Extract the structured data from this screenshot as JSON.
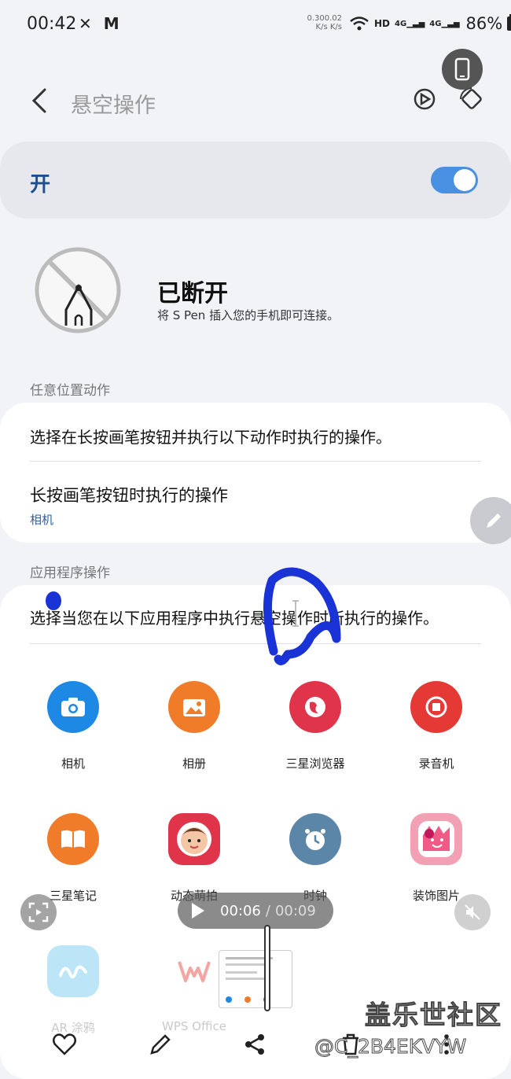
{
  "status_bar": {
    "time": "00:42",
    "left_icons": "✕ M",
    "speed_up": "0.30",
    "speed_down": "0.02",
    "speed_unit_up": "K/s",
    "speed_unit_down": "K/s",
    "network": "HD",
    "signal1": "4G",
    "signal2": "4G",
    "battery": "86%"
  },
  "header": {
    "title": "悬空操作",
    "icons": [
      "back-arrow-icon",
      "screen-rotate-icon",
      "auto-rotate-icon",
      "phone-icon"
    ]
  },
  "master_switch": {
    "label": "开",
    "state": "on",
    "accent": "#4a90e2"
  },
  "pen_status": {
    "title": "已断开",
    "description": "将 S Pen 插入您的手机即可连接。"
  },
  "anywhere_section": {
    "label": "任意位置动作",
    "description": "选择在长按画笔按钮并执行以下动作时执行的操作。",
    "long_press_title": "长按画笔按钮时执行的操作",
    "long_press_value": "相机"
  },
  "app_section": {
    "label": "应用程序操作",
    "description": "选择当您在以下应用程序中执行悬空操作时所执行的操作。",
    "apps": [
      {
        "name": "相机",
        "color": "#1e88e5",
        "icon": "camera-icon"
      },
      {
        "name": "相册",
        "color": "#f07c2a",
        "icon": "gallery-icon"
      },
      {
        "name": "三星浏览器",
        "color": "#e0344a",
        "icon": "browser-icon"
      },
      {
        "name": "录音机",
        "color": "#e53935",
        "icon": "recorder-icon"
      },
      {
        "name": "三星笔记",
        "color": "#f07c2a",
        "icon": "notes-icon"
      },
      {
        "name": "动态萌拍",
        "color": "#e0344a",
        "icon": "ar-emoji-icon"
      },
      {
        "name": "时钟",
        "color": "#5b86a8",
        "icon": "clock-icon"
      },
      {
        "name": "装饰图片",
        "color": "#f2a0b4",
        "icon": "decorate-icon"
      },
      {
        "name": "AR 涂鸦",
        "color": "#6ec6f0",
        "icon": "ar-doodle-icon"
      },
      {
        "name": "WPS Office",
        "color": "#ffffff",
        "icon": "wps-icon"
      }
    ]
  },
  "video_overlay": {
    "current": "00:06",
    "separator": "/",
    "total": "00:09"
  },
  "watermark": {
    "site": "盖乐世社区",
    "user": "@C_2B4EKVYW"
  }
}
